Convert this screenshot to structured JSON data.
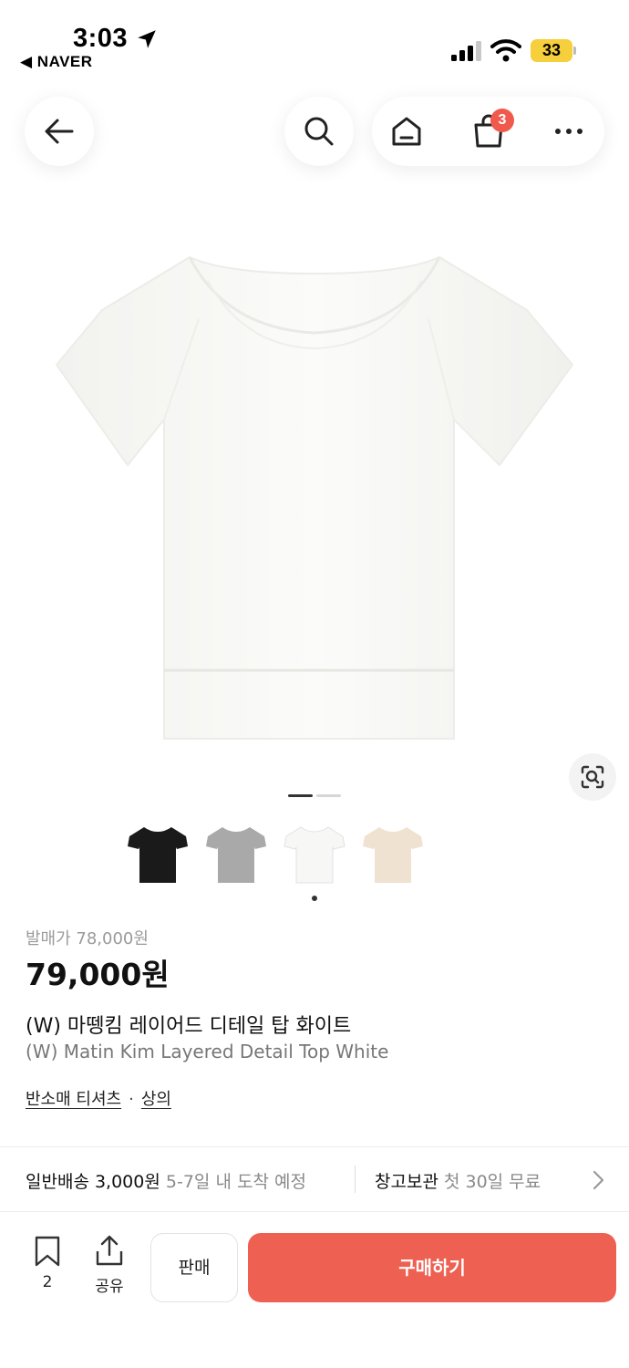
{
  "status_bar": {
    "time": "3:03",
    "back_app": "◀ NAVER",
    "battery": "33"
  },
  "nav": {
    "cart_count": "3"
  },
  "gallery": {
    "current_page": 1,
    "total_pages": 2
  },
  "swatches": [
    {
      "name": "black",
      "color": "#1a1a1a"
    },
    {
      "name": "gray",
      "color": "#a9a9a9"
    },
    {
      "name": "white",
      "color": "#f7f7f5"
    },
    {
      "name": "beige",
      "color": "#efe2d1"
    }
  ],
  "selected_swatch": 3,
  "product": {
    "original_price": "발매가 78,000원",
    "price": "79,000원",
    "title_ko": "(W) 마뗑킴 레이어드 디테일 탑 화이트",
    "title_en": "(W) Matin Kim Layered Detail Top White",
    "category_1": "반소매 티셔츠",
    "category_sep": "·",
    "category_2": "상의"
  },
  "delivery": {
    "label": "일반배송 3,000원",
    "eta": "5-7일 내 도착 예정",
    "storage_label": "창고보관",
    "storage_note": "첫 30일 무료"
  },
  "bottom_bar": {
    "bookmark_count": "2",
    "share_label": "공유",
    "sell_label": "판매",
    "buy_label": "구매하기"
  },
  "colors": {
    "accent": "#ee6052",
    "badge": "#ef5a4d"
  }
}
